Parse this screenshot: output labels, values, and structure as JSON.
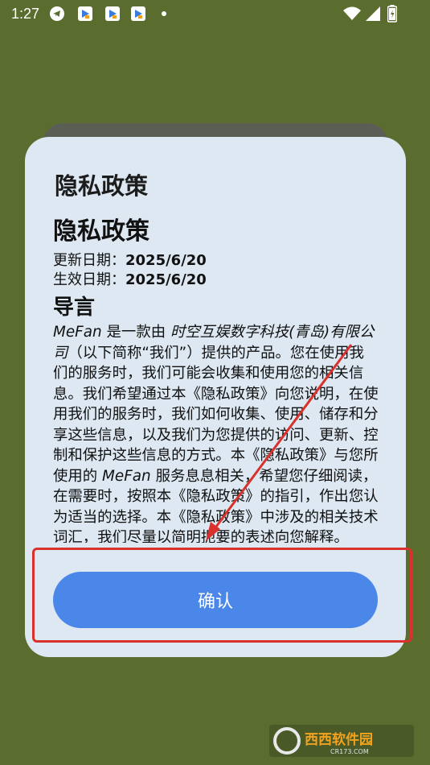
{
  "status_bar": {
    "time": "1:27",
    "icons": [
      "telegram-icon",
      "app-icon",
      "app-icon",
      "app-icon",
      "dot-icon",
      "wifi-icon",
      "signal-icon",
      "battery-icon"
    ]
  },
  "dialog": {
    "title": "隐私政策",
    "policy_heading": "隐私政策",
    "updated_label": "更新日期：",
    "updated_date": "2025/6/20",
    "effective_label": "生效日期：",
    "effective_date": "2025/6/20",
    "section_heading": "导言",
    "intro_app": "MeFan",
    "intro_part1": " 是一款由 ",
    "intro_company": "时空互娱数字科技(青岛)有限公司",
    "intro_part2": "（以下简称“我们”）提供的产品。您在使用我们的服务时，我们可能会收集和使用您的相关信息。我们希望通过本《隐私政策》向您说明，在使用我们的服务时，我们如何收集、使用、储存和分享这些信息，以及我们为您提供的访问、更新、控制和保护这些信息的方式。本《隐私政策》与您所使用的 ",
    "intro_app2": "MeFan",
    "intro_part3": " 服务息息相关，希望您仔细阅读，在需要时，按照本《隐私政策》的指引，作出您认为适当的选择。本《隐私政策》中涉及的相关技术词汇，我们尽量以简明扼要的表述向您解释。",
    "confirm_label": "确认"
  },
  "watermark": {
    "brand": "西西软件园",
    "domain": "CR173.COM"
  },
  "colors": {
    "background": "#5a6d2e",
    "dialog": "#dde8f2",
    "button": "#4a87e8",
    "annotation": "#d9312b"
  }
}
